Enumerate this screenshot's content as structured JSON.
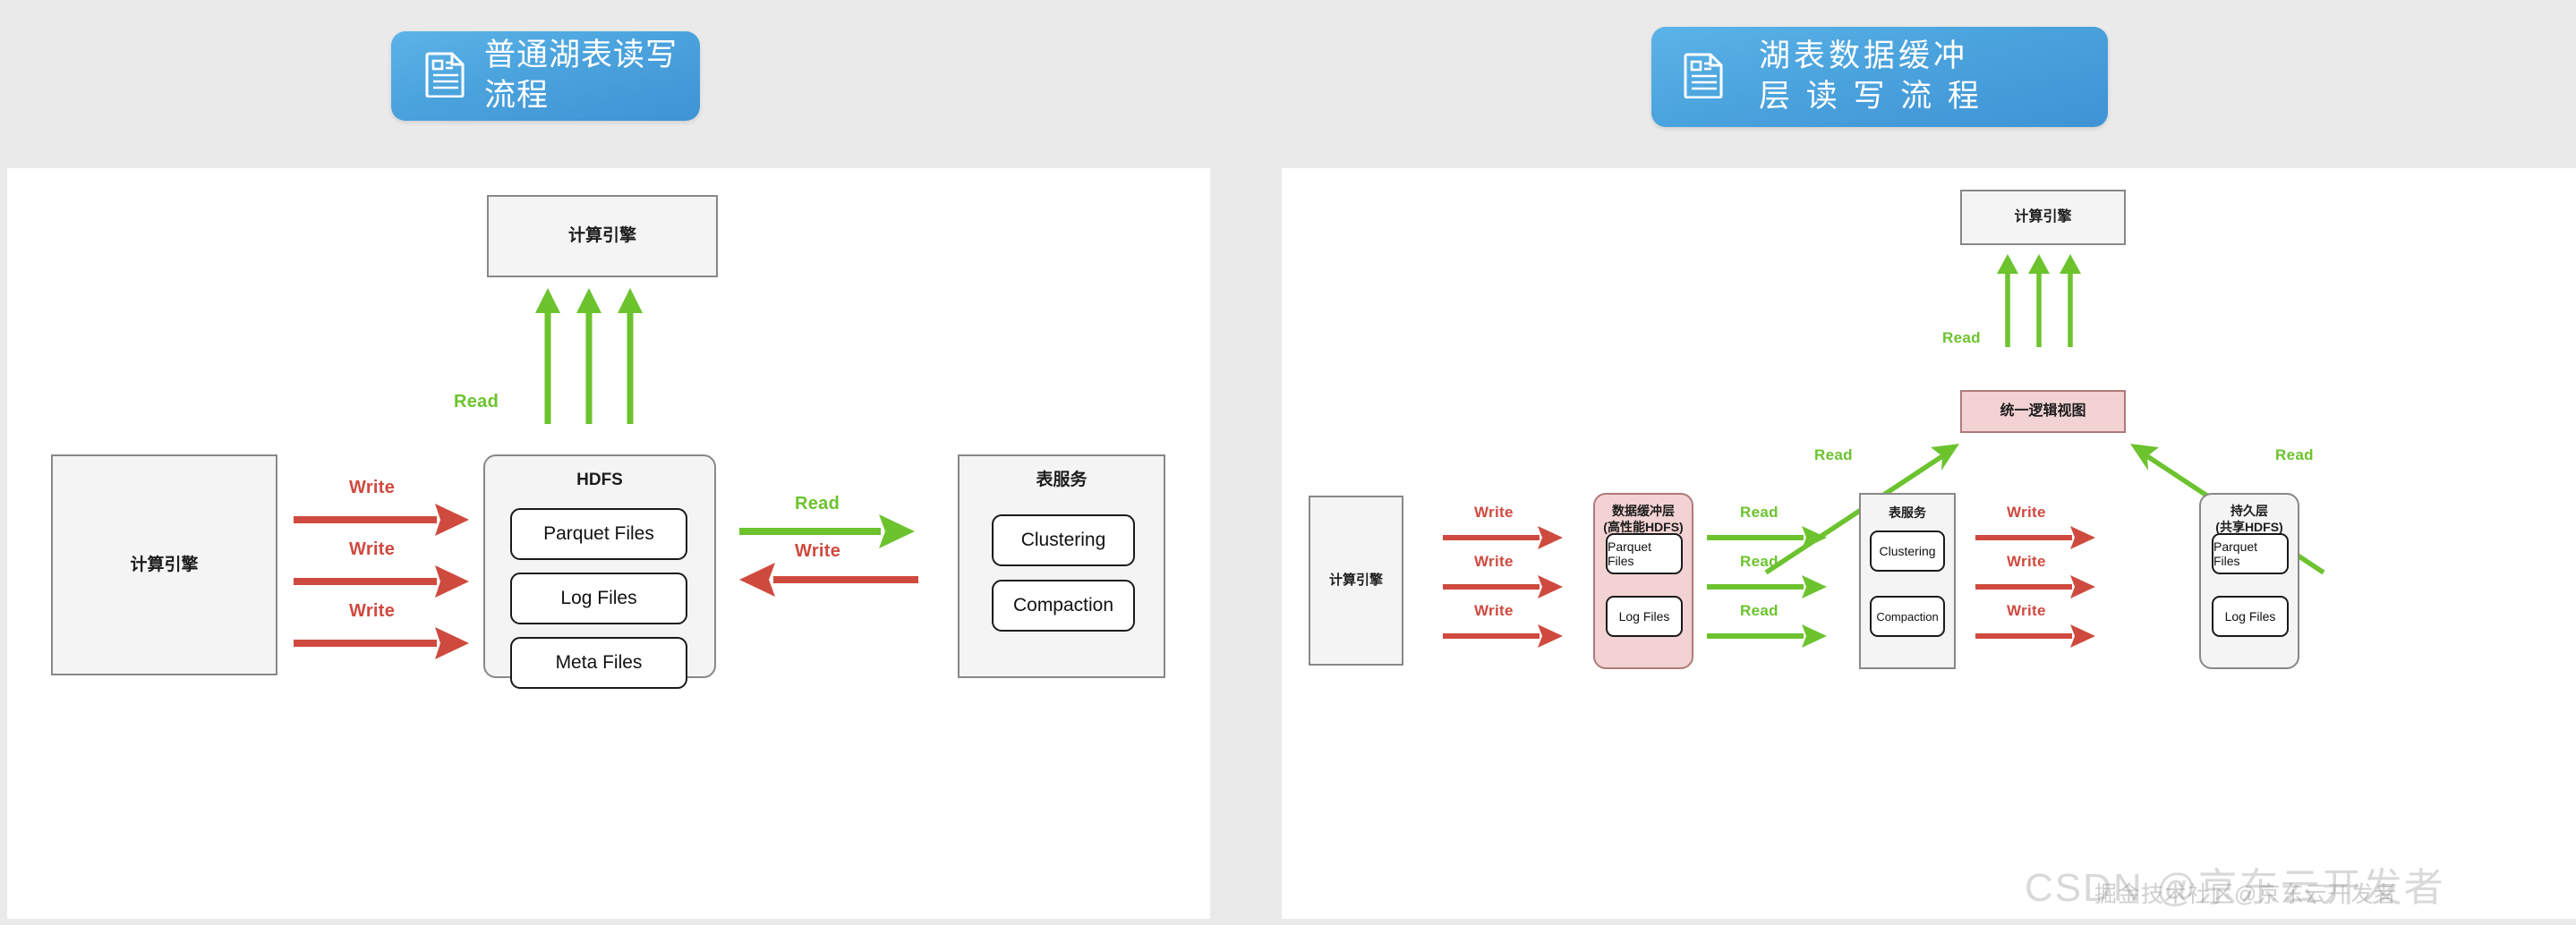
{
  "headers": {
    "left": {
      "icon": "document-icon",
      "title": "普通湖表读写流程"
    },
    "right": {
      "icon": "document-icon",
      "title": "湖表数据缓冲\n层 读 写 流 程"
    }
  },
  "colors": {
    "pill_blue": "#4ba3dd",
    "read_green": "#6cc32e",
    "write_red": "#d0493f",
    "buffer_pink": "#f2d2d2",
    "box_gray": "#f4f4f4",
    "panel_white": "#ffffff",
    "page_bg": "#eaeaea"
  },
  "left_diagram": {
    "compute_engine_top": "计算引擎",
    "compute_engine_left": "计算引擎",
    "hdfs": {
      "title": "HDFS",
      "files": [
        "Parquet Files",
        "Log Files",
        "Meta Files"
      ]
    },
    "table_service": {
      "title": "表服务",
      "items": [
        "Clustering",
        "Compaction"
      ]
    },
    "arrows": [
      {
        "label": "Read",
        "direction": "up",
        "kind": "read",
        "count": 3
      },
      {
        "label": "Write",
        "direction": "right",
        "kind": "write",
        "count": 3
      },
      {
        "label": "Read",
        "direction": "right",
        "kind": "read",
        "count": 1
      },
      {
        "label": "Write",
        "direction": "left",
        "kind": "write",
        "count": 1
      }
    ]
  },
  "right_diagram": {
    "compute_engine_top": "计算引擎",
    "compute_engine_left": "计算引擎",
    "unified_view": "统一逻辑视图",
    "buffer_layer": {
      "title": "数据缓冲层\n(高性能HDFS)",
      "files": [
        "Parquet Files",
        "Log Files"
      ]
    },
    "table_service": {
      "title": "表服务",
      "items": [
        "Clustering",
        "Compaction"
      ]
    },
    "persist_layer": {
      "title": "持久层\n(共享HDFS)",
      "files": [
        "Parquet Files",
        "Log Files"
      ]
    },
    "arrows": [
      {
        "label": "Read",
        "direction": "up",
        "kind": "read",
        "count": 3
      },
      {
        "label": "Read",
        "direction": "up-right",
        "kind": "read",
        "count": 1
      },
      {
        "label": "Read",
        "direction": "up-left",
        "kind": "read",
        "count": 1
      },
      {
        "label": "Write",
        "direction": "right",
        "kind": "write",
        "count": 3
      },
      {
        "label": "Read",
        "direction": "right",
        "kind": "read",
        "count": 3
      },
      {
        "label": "Write",
        "direction": "right",
        "kind": "write",
        "count": 3
      }
    ]
  },
  "watermarks": {
    "csdn": "CSDN @京东云开发者",
    "juejin": "掘金技术社区@京东云开发者"
  }
}
